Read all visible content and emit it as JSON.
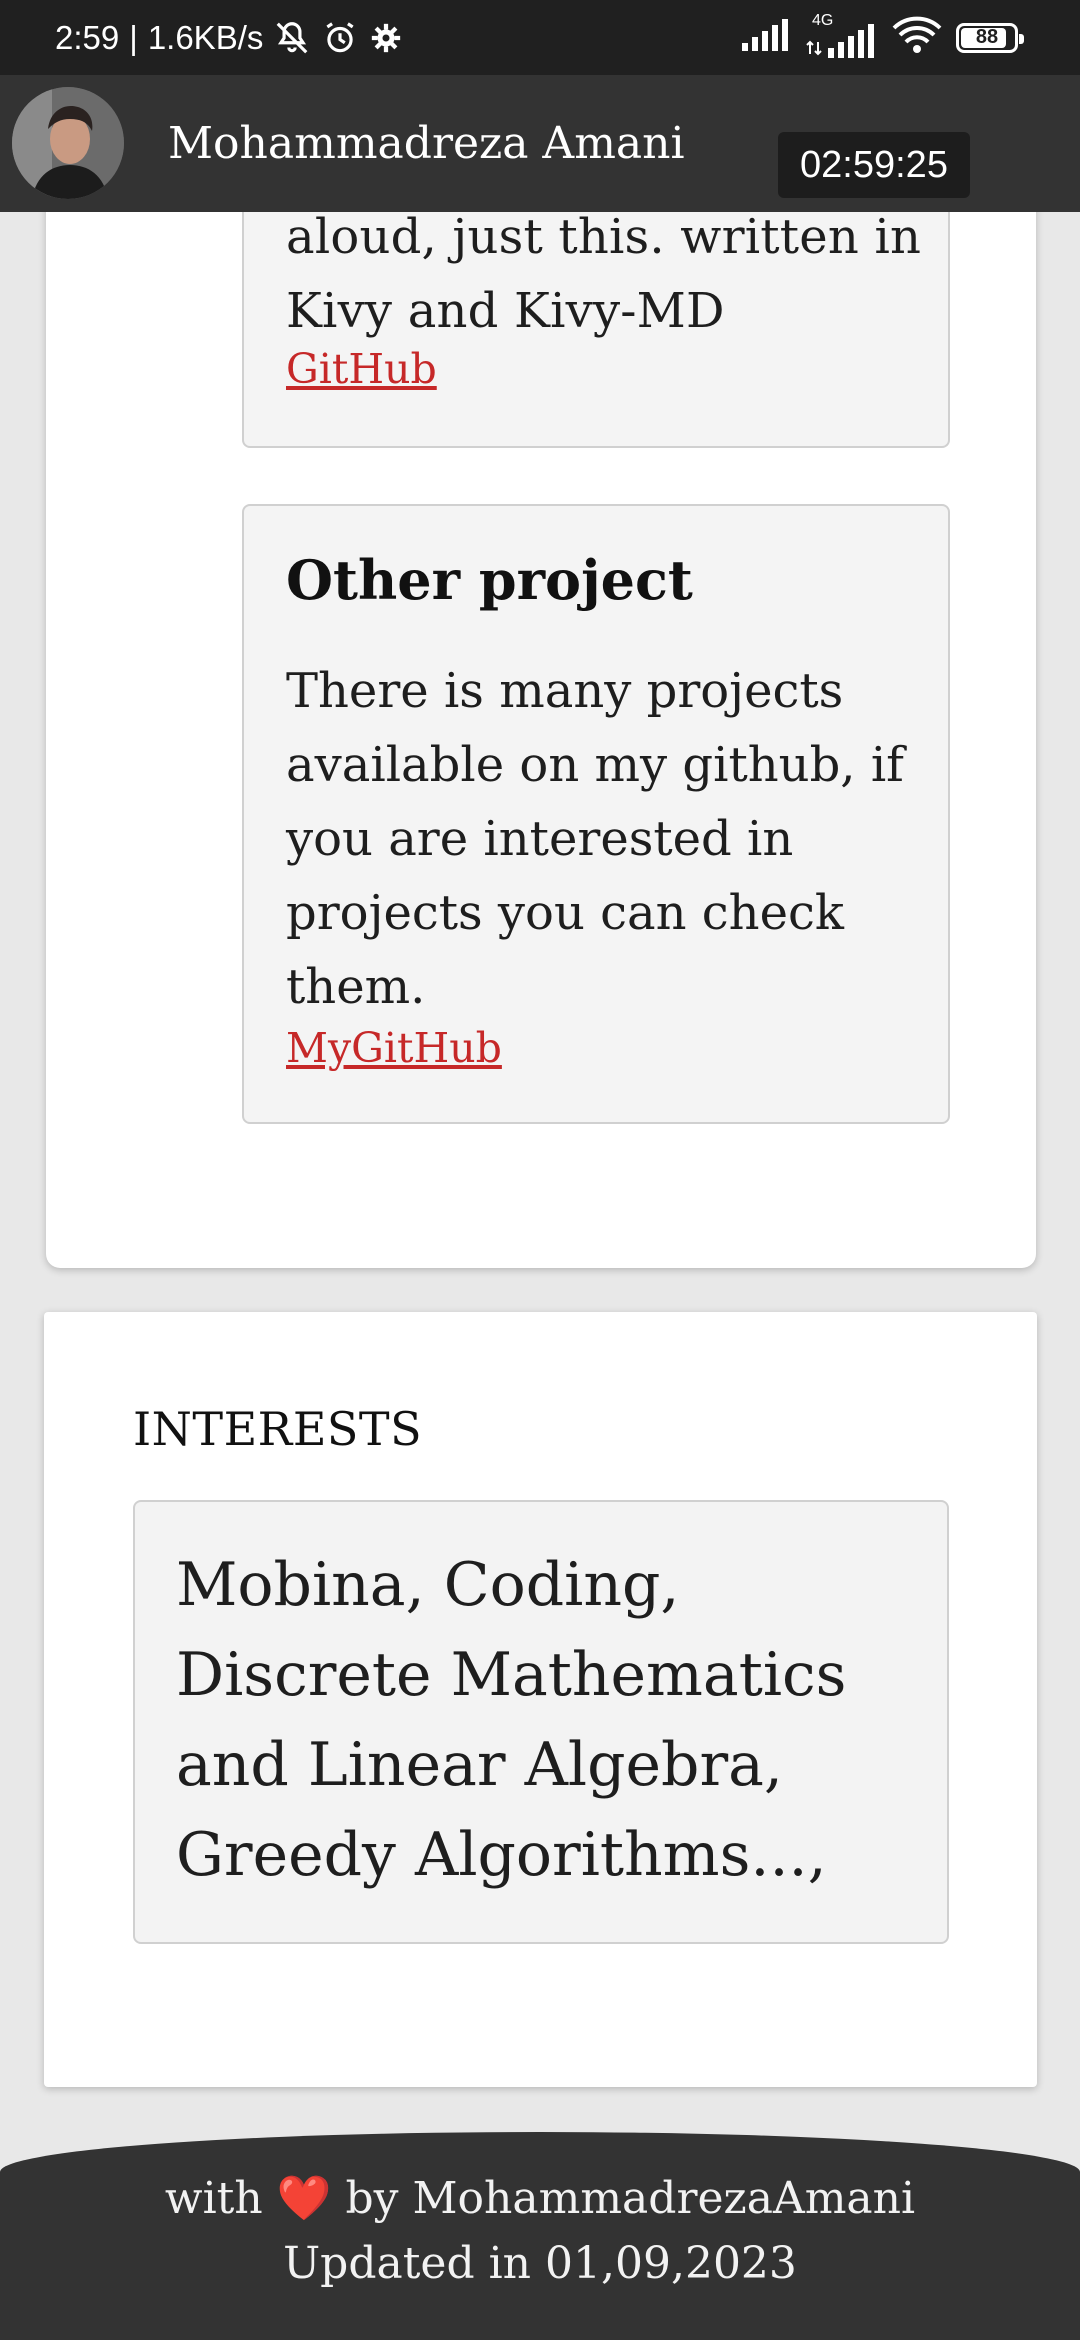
{
  "status_bar": {
    "time": "2:59",
    "separator": "|",
    "network_speed": "1.6KB/s",
    "network_type": "4G",
    "battery_level": "88",
    "battery_fraction": 0.88,
    "icons": [
      "bell-off-icon",
      "alarm-icon",
      "settings-gear-icon",
      "signal-icon",
      "signal-4g-icon",
      "wifi-icon",
      "battery-icon"
    ]
  },
  "header": {
    "title": "Mohammadreza Amani",
    "clock": "02:59:25",
    "avatar": "profile-photo"
  },
  "projects": {
    "previous_card": {
      "description_lines": [
        "aloud, just this. written in",
        "Kivy and Kivy-MD"
      ],
      "link_label": "GitHub"
    },
    "other_card": {
      "title": "Other project",
      "description": "There is many projects available on my github, if you are interested in projects you can check them.",
      "link_label": "MyGitHub"
    }
  },
  "interests": {
    "heading": "INTERESTS",
    "text": "Mobina, Coding, Discrete Mathematics and Linear Algebra, Greedy Algorithms...,"
  },
  "footer": {
    "prefix": "with",
    "heart": "❤️",
    "suffix": "by MohammadrezaAmani",
    "updated": "Updated in 01,09,2023"
  },
  "colors": {
    "header_bg": "#333333",
    "status_bg": "#202020",
    "link": "#c62828",
    "card_bg": "#f4f4f4",
    "heart": "#e0242e"
  }
}
